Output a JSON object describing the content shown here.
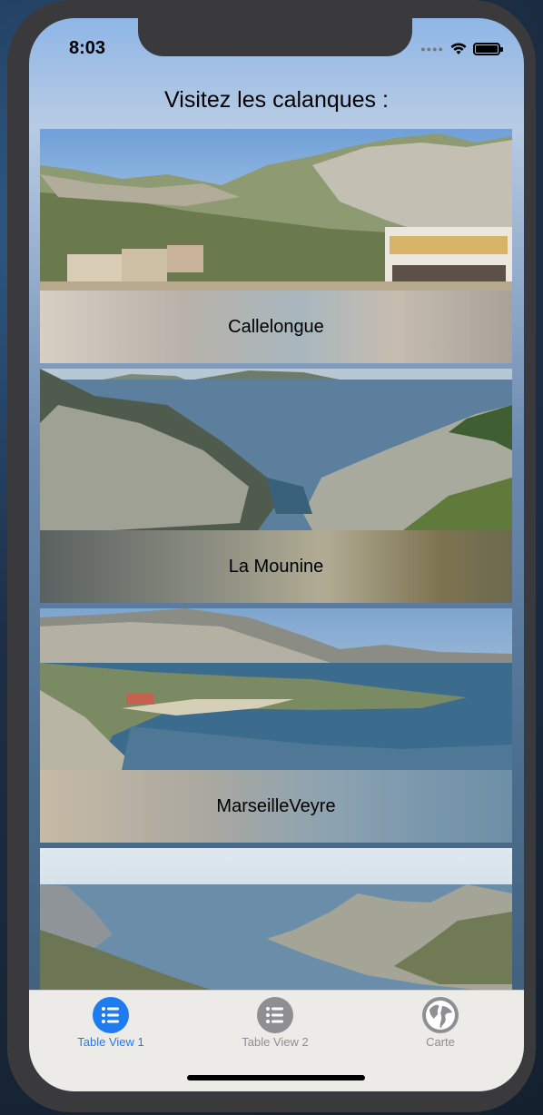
{
  "status_bar": {
    "time": "8:03"
  },
  "header": {
    "title": "Visitez les calanques :"
  },
  "table": {
    "rows": [
      {
        "label": "Callelongue"
      },
      {
        "label": "La Mounine"
      },
      {
        "label": "MarseilleVeyre"
      },
      {
        "label": ""
      }
    ]
  },
  "tab_bar": {
    "tabs": [
      {
        "label": "Table View 1",
        "icon": "list-icon",
        "selected": true
      },
      {
        "label": "Table View 2",
        "icon": "list-icon",
        "selected": false
      },
      {
        "label": "Carte",
        "icon": "globe-icon",
        "selected": false
      }
    ],
    "colors": {
      "active": "#1e7bf0",
      "inactive": "#8e8e93"
    }
  }
}
